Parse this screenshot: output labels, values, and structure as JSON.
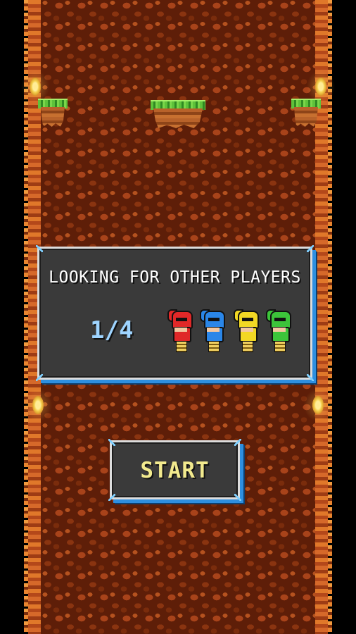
{
  "lobby": {
    "status_text": "LOOKING FOR OTHER PLAYERS",
    "player_count": "1/4",
    "players": [
      {
        "color": "red",
        "hex": "#e02828"
      },
      {
        "color": "blue",
        "hex": "#2a86e8"
      },
      {
        "color": "yellow",
        "hex": "#f2d824"
      },
      {
        "color": "green",
        "hex": "#3cc43a"
      }
    ]
  },
  "start_button": {
    "label": "START"
  },
  "scene": {
    "background": "cave-shaft",
    "props": [
      "torch-icon",
      "grass-ledge"
    ]
  }
}
